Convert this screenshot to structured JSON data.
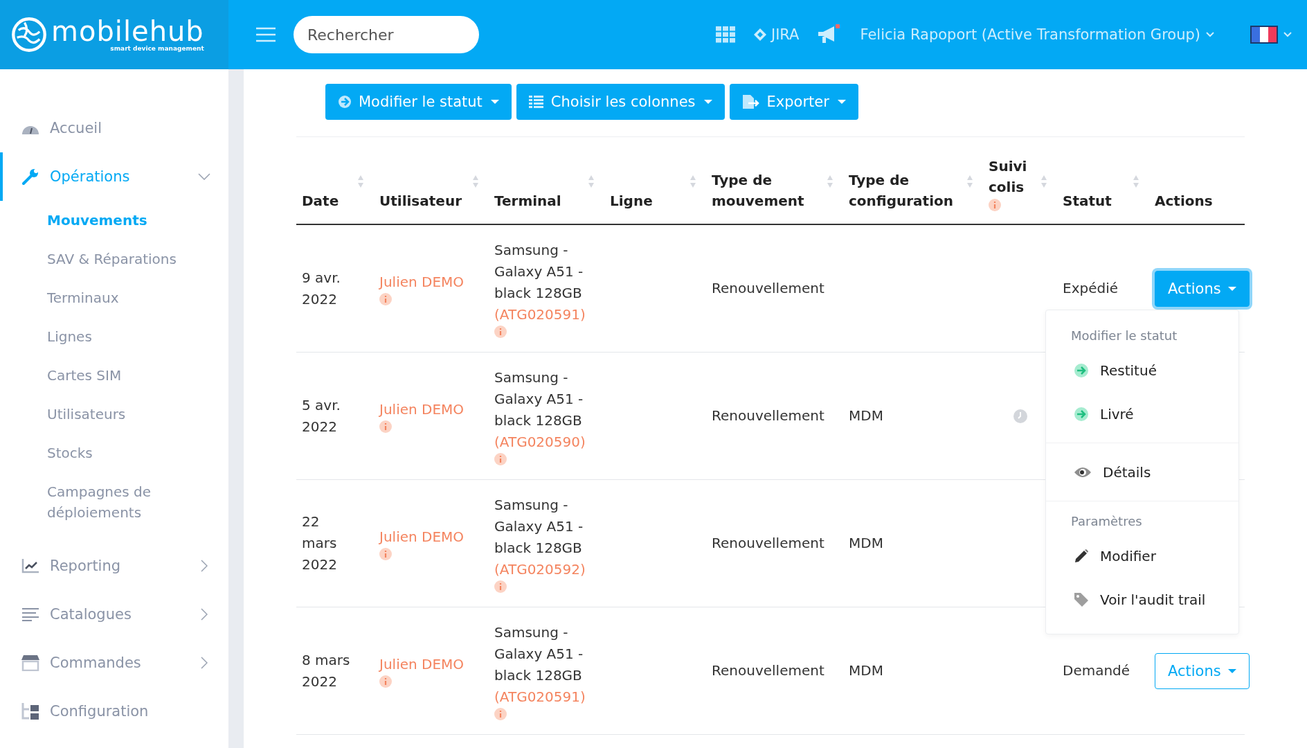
{
  "header": {
    "logo": "mobilehub",
    "logo_tagline": "smart device management",
    "search": {
      "placeholder": "Rechercher"
    },
    "jira": "JIRA",
    "user": "Felicia Rapoport (Active Transformation Group)"
  },
  "sidebar": {
    "items": [
      {
        "label": "Accueil",
        "selected": false
      },
      {
        "label": "Opérations",
        "selected": true,
        "expanded": true,
        "children": [
          {
            "label": "Mouvements",
            "selected": true
          },
          {
            "label": "SAV & Réparations",
            "selected": false
          },
          {
            "label": "Terminaux",
            "selected": false
          },
          {
            "label": "Lignes",
            "selected": false
          },
          {
            "label": "Cartes SIM",
            "selected": false
          },
          {
            "label": "Utilisateurs",
            "selected": false
          },
          {
            "label": "Stocks",
            "selected": false
          },
          {
            "label": "Campagnes de déploiements",
            "selected": false
          }
        ]
      },
      {
        "label": "Reporting",
        "selected": false,
        "expanded": false
      },
      {
        "label": "Catalogues",
        "selected": false,
        "expanded": false
      },
      {
        "label": "Commandes",
        "selected": false,
        "expanded": false
      },
      {
        "label": "Configuration",
        "selected": false
      }
    ]
  },
  "toolbar": [
    "Modifier le statut",
    "Choisir les colonnes",
    "Exporter"
  ],
  "table": {
    "columns": [
      {
        "label": "Date",
        "sortable": true
      },
      {
        "label": "Utilisateur",
        "sortable": true
      },
      {
        "label": "Terminal",
        "sortable": true
      },
      {
        "label": "Ligne",
        "sortable": true
      },
      {
        "label": "Type de mouvement",
        "sortable": true
      },
      {
        "label": "Type de configuration",
        "sortable": true
      },
      {
        "label": "Suivi colis",
        "sortable": true,
        "info": true
      },
      {
        "label": "Statut",
        "sortable": true
      },
      {
        "label": "Actions",
        "sortable": false
      }
    ],
    "rows": [
      {
        "date": "9 avr. 2022",
        "user": "Julien DEMO",
        "terminal": "Samsung - Galaxy A51 - black 128GB",
        "terminal_code": "(ATG020591)",
        "movement_type": "Renouvellement",
        "tracking_pending": false,
        "status": "Expédié",
        "action_button": {
          "label": "Actions",
          "open": true
        }
      },
      {
        "date": "5 avr. 2022",
        "user": "Julien DEMO",
        "terminal": "Samsung - Galaxy A51 - black 128GB",
        "terminal_code": "(ATG020590)",
        "movement_type": "Renouvellement",
        "config_type": "MDM",
        "tracking_pending": true
      },
      {
        "date": "22 mars 2022",
        "user": "Julien DEMO",
        "terminal": "Samsung - Galaxy A51 - black 128GB",
        "terminal_code": "(ATG020592)",
        "movement_type": "Renouvellement",
        "config_type": "MDM",
        "tracking_pending": false
      },
      {
        "date": "8 mars 2022",
        "user": "Julien DEMO",
        "terminal": "Samsung - Galaxy A51 - black 128GB",
        "terminal_code": "(ATG020591)",
        "movement_type": "Renouvellement",
        "config_type": "MDM",
        "tracking_pending": false,
        "status": "Demandé",
        "action_button": {
          "label": "Actions",
          "open": false
        }
      }
    ]
  },
  "actions_menu": {
    "sections": [
      {
        "heading": "Modifier le statut",
        "items": [
          {
            "label": "Restitué",
            "kind": "arrow"
          },
          {
            "label": "Livré",
            "kind": "arrow"
          }
        ]
      },
      {
        "items": [
          {
            "label": "Détails",
            "kind": "eye"
          }
        ]
      },
      {
        "heading": "Paramètres",
        "items": [
          {
            "label": "Modifier",
            "kind": "pencil"
          },
          {
            "label": "Voir l'audit trail",
            "kind": "tag"
          }
        ]
      }
    ]
  }
}
